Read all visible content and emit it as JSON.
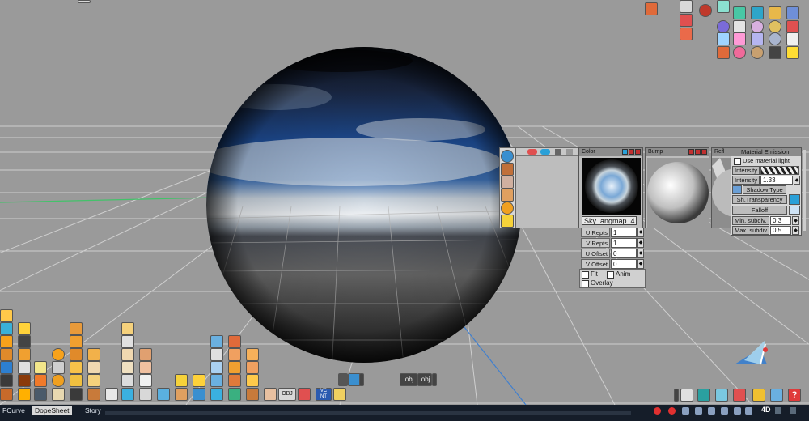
{
  "colors": {
    "viewport_bg": "#9a9a9a",
    "grid_line": "#cfcfcf",
    "axis_green": "#43c26a",
    "axis_blue": "#3f7fd0",
    "panel_bg": "#bdbdbd",
    "title_bar": "#8c8c8c",
    "bottom_bar": "#151d29",
    "accent_red": "#c03030"
  },
  "material_editor": {
    "slots": [
      {
        "title": "Color"
      },
      {
        "title": "Bump"
      },
      {
        "title": "Refl"
      }
    ],
    "map_name": "Sky_angmap_4",
    "params": [
      {
        "label": "U Repts",
        "value": "1"
      },
      {
        "label": "V Repts",
        "value": "1"
      },
      {
        "label": "U Offset",
        "value": "0"
      },
      {
        "label": "V Offset",
        "value": "0"
      }
    ],
    "checks": [
      {
        "label": "Fit",
        "checked": false
      },
      {
        "label": "Anim",
        "checked": false
      },
      {
        "label": "Overlay",
        "checked": false
      }
    ]
  },
  "emission_panel": {
    "title": "Material Emission",
    "use_material_light": "Use material light",
    "intensity_label": "Intensity",
    "intensity2_label": "Intensity",
    "intensity_value": "1.33",
    "shadow_type": "Shadow Type",
    "sh_transparency": "Sh.Transparency",
    "falloff": "Falloff",
    "min_subdiv_label": "Min. subdiv.",
    "min_subdiv_value": "0.3",
    "max_subdiv_label": "Max. subdiv.",
    "max_subdiv_value": "0.5"
  },
  "bottom_bar": {
    "tabs": [
      {
        "label": "FCurve"
      },
      {
        "label": "DopeSheet"
      },
      {
        "label": "Story"
      }
    ],
    "mode_label": "4D"
  },
  "object_labels": {
    "obj1": ".obj",
    "obj2": ".obj",
    "obj3": "OBJ",
    "vc": "VC",
    "nt": "NT"
  }
}
